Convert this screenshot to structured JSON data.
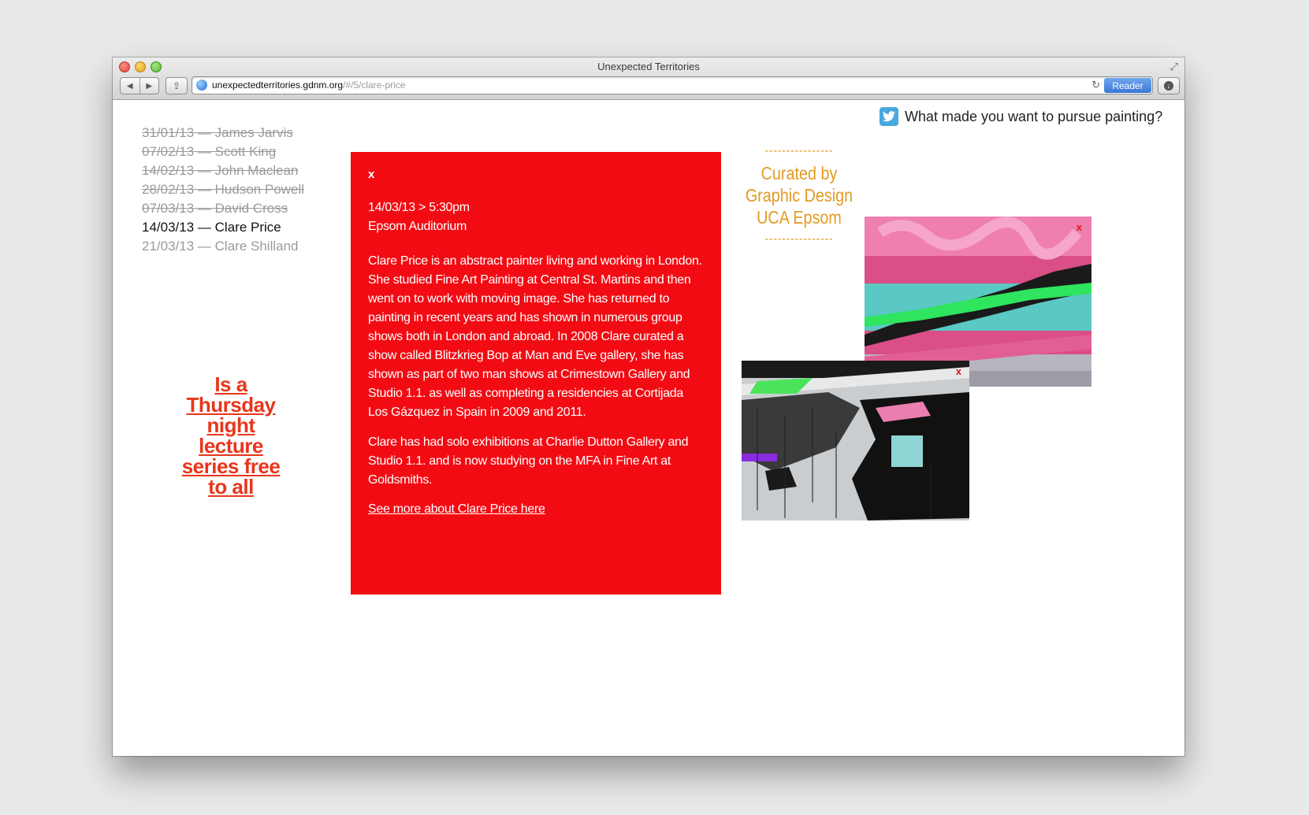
{
  "browser": {
    "window_title": "Unexpected Territories",
    "url_host": "unexpectedterritories.gdnm.org",
    "url_path": "/#/5/clare-price",
    "reader_label": "Reader"
  },
  "lectures": [
    {
      "date": "31/01/13",
      "name": "James Jarvis",
      "state": "past"
    },
    {
      "date": "07/02/13",
      "name": "Scott King",
      "state": "past"
    },
    {
      "date": "14/02/13",
      "name": "John Maclean",
      "state": "past"
    },
    {
      "date": "28/02/13",
      "name": "Hudson Powell",
      "state": "past"
    },
    {
      "date": "07/03/13",
      "name": "David Cross",
      "state": "past"
    },
    {
      "date": "14/03/13",
      "name": "Clare Price",
      "state": "current"
    },
    {
      "date": "21/03/13",
      "name": "Clare Shilland",
      "state": "upcoming"
    }
  ],
  "separator": "—",
  "tagline": {
    "lines": [
      "Is a",
      "Thursday",
      "night",
      "lecture",
      "series free",
      "to all"
    ]
  },
  "info": {
    "close_label": "x",
    "date_time": "14/03/13 > 5:30pm",
    "venue": "Epsom Auditorium",
    "paragraphs": [
      "Clare Price is an abstract painter living and working in London. She studied Fine Art Painting at Central St. Martins and then went on to work with moving image. She has returned to painting in recent years and has shown in numerous group shows both in London and abroad. In 2008 Clare curated a show called Blitzkrieg Bop at Man and Eve gallery, she has shown as part of two man shows at Crimestown Gallery and Studio 1.1. as well as completing a residencies at Cortijada Los Gázquez in Spain in 2009 and 2011.",
      "Clare has had solo exhibitions at Charlie Dutton Gallery and Studio 1.1. and is now studying on the MFA in Fine Art at Goldsmiths."
    ],
    "link_label": "See more about Clare Price here"
  },
  "tweet": {
    "icon": "twitter-icon",
    "question": "What made you want to pursue painting?"
  },
  "curated": {
    "dashes": "----------------",
    "lines": [
      "Curated by",
      "Graphic Design",
      "UCA Epsom"
    ]
  },
  "artworks": [
    {
      "close_label": "x"
    },
    {
      "close_label": "x"
    }
  ],
  "colors": {
    "info_bg": "#f30b13",
    "tagline": "#e8361c",
    "curated": "#e39a24",
    "twitter": "#4aa8e0"
  }
}
